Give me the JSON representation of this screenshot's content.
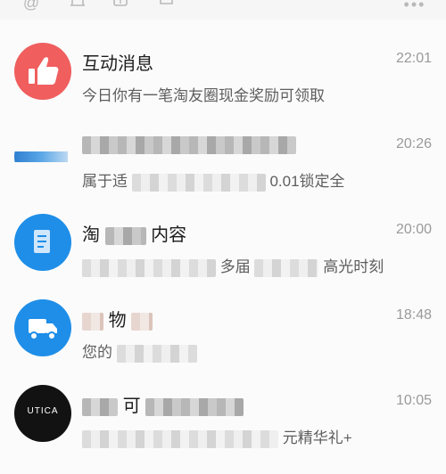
{
  "topbar": {
    "icons": [
      "at-icon",
      "bell-icon",
      "yen-icon",
      "puzzle-icon",
      "more-icon"
    ]
  },
  "conversations": [
    {
      "avatar": "thumbs-up-icon",
      "avatar_color": "#f05e5e",
      "title": "互动消息",
      "subtitle": "今日你有一笔淘友圈现金奖励可领取",
      "time": "22:01"
    },
    {
      "avatar": "blurred-avatar",
      "title_visible": "",
      "subtitle_prefix": "属于适",
      "subtitle_suffix": "0.01锁定全",
      "time": "20:26"
    },
    {
      "avatar": "document-icon",
      "avatar_color": "#1e8ee8",
      "title_prefix": "淘",
      "title_suffix": "内容",
      "subtitle_mid": "多届",
      "subtitle_suffix": "高光时刻",
      "time": "20:00"
    },
    {
      "avatar": "truck-icon",
      "avatar_color": "#1e8ee8",
      "title_mid": "物",
      "subtitle_prefix": "您的",
      "time": "18:48"
    },
    {
      "avatar": "brand-logo",
      "avatar_color": "#121212",
      "avatar_text": "UTICA",
      "title_mid": "可",
      "subtitle_suffix": "元精华礼+",
      "time": "10:05"
    }
  ]
}
